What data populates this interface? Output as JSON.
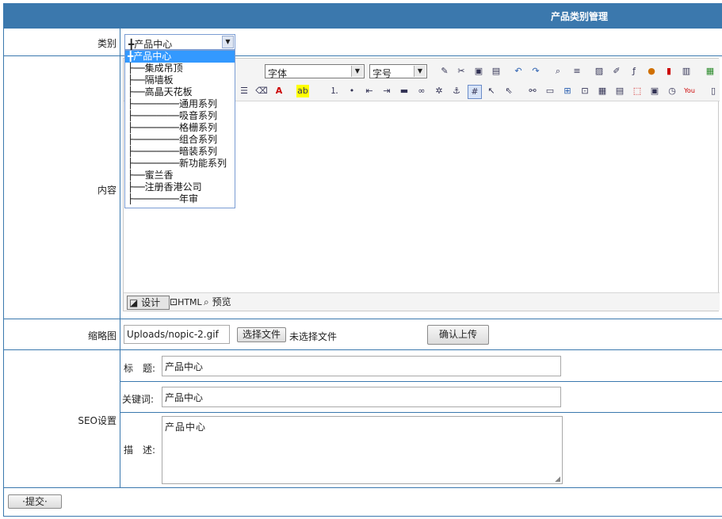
{
  "header": {
    "title": "产品类别管理"
  },
  "category": {
    "label": "类别",
    "selected": "╋产品中心",
    "options": [
      "╋产品中心",
      "├──集成吊顶",
      "├──隔墙板",
      "├──高晶天花板",
      "├────────通用系列",
      "├────────吸音系列",
      "├────────格栅系列",
      "├────────组合系列",
      "├────────暗装系列",
      "├────────新功能系列",
      "├──蜜兰香",
      "├──注册香港公司",
      "├────────年审"
    ]
  },
  "content": {
    "label": "内容",
    "font_select": "字体",
    "size_select": "字号",
    "footer_tabs": {
      "design": "设计",
      "html": "HTML",
      "preview": "预览"
    }
  },
  "thumbnail": {
    "label": "缩略图",
    "value": "Uploads/nopic-2.gif",
    "choose_file": "选择文件",
    "no_file": "未选择文件",
    "upload": "确认上传"
  },
  "seo": {
    "label": "SEO设置",
    "title_label": "标　题:",
    "title_value": "产品中心",
    "keywords_label": "关键词:",
    "keywords_value": "产品中心",
    "desc_label": "描　述:",
    "desc_value": "产品中心"
  },
  "submit": "·提交·"
}
